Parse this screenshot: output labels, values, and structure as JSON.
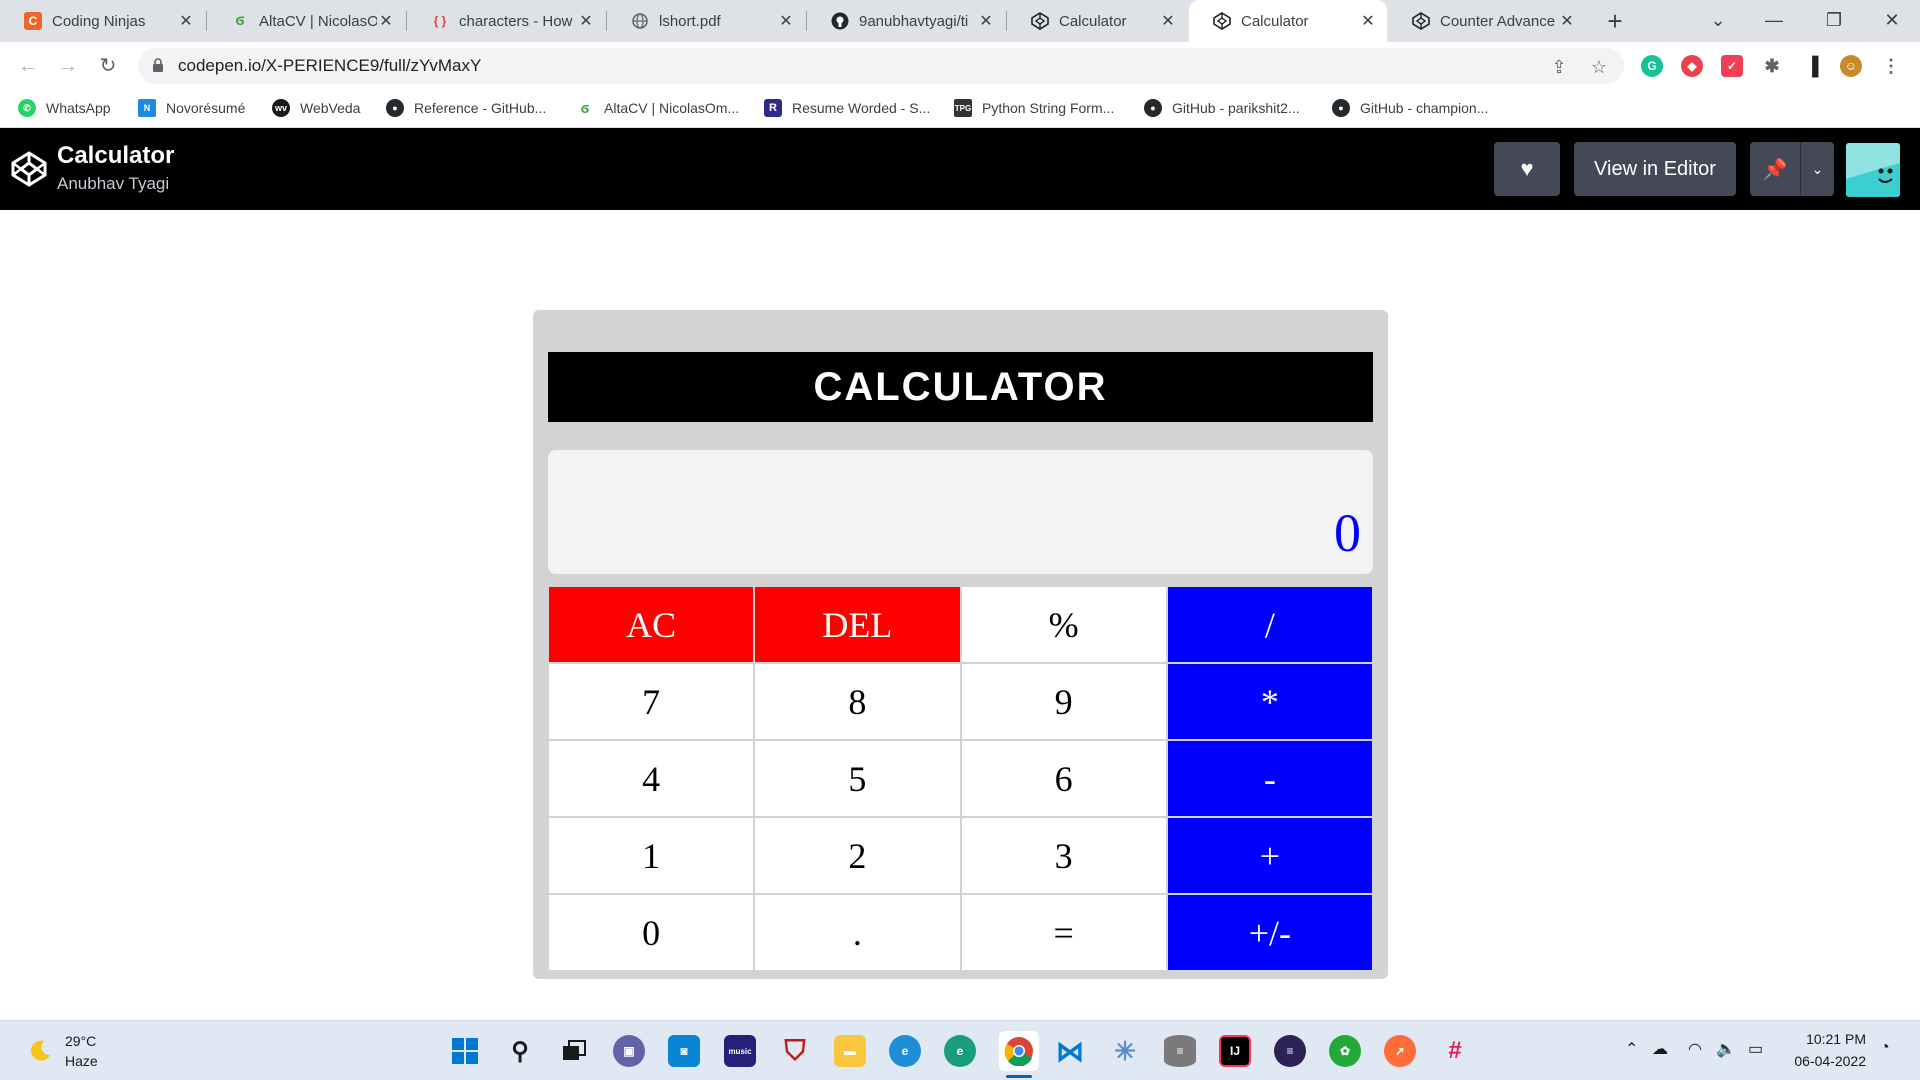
{
  "browser": {
    "tabs": [
      {
        "title": "Coding Ninjas",
        "icon": "coding-ninjas-icon",
        "active": false
      },
      {
        "title": "AltaCV | NicolasO",
        "icon": "overleaf-icon",
        "active": false
      },
      {
        "title": "characters - How",
        "icon": "braces-icon",
        "active": false
      },
      {
        "title": "lshort.pdf",
        "icon": "globe-icon",
        "active": false
      },
      {
        "title": "9anubhavtyagi/ti",
        "icon": "github-icon",
        "active": false
      },
      {
        "title": "Calculator",
        "icon": "codepen-icon",
        "active": false
      },
      {
        "title": "Calculator",
        "icon": "codepen-icon",
        "active": true
      },
      {
        "title": "Counter Advance",
        "icon": "codepen-icon",
        "active": false
      }
    ],
    "url": "codepen.io/X-PERIENCE9/full/zYvMaxY",
    "bookmarks": [
      {
        "label": "WhatsApp",
        "icon": "whatsapp-icon"
      },
      {
        "label": "Novorésumé",
        "icon": "novoresume-icon"
      },
      {
        "label": "WebVeda",
        "icon": "webveda-icon"
      },
      {
        "label": "Reference - GitHub...",
        "icon": "github-icon"
      },
      {
        "label": "AltaCV | NicolasOm...",
        "icon": "overleaf-icon"
      },
      {
        "label": "Resume Worded - S...",
        "icon": "resume-worded-icon"
      },
      {
        "label": "Python String Form...",
        "icon": "tpg-icon"
      },
      {
        "label": "GitHub - parikshit2...",
        "icon": "github-icon"
      },
      {
        "label": "GitHub - champion...",
        "icon": "github-icon"
      }
    ]
  },
  "codepen": {
    "title": "Calculator",
    "author": "Anubhav Tyagi",
    "view_in_editor": "View in Editor"
  },
  "calculator": {
    "heading": "CALCULATOR",
    "display": "0",
    "keys": [
      {
        "label": "AC",
        "style": "red"
      },
      {
        "label": "DEL",
        "style": "red"
      },
      {
        "label": "%",
        "style": "white"
      },
      {
        "label": "/",
        "style": "blue"
      },
      {
        "label": "7",
        "style": "white"
      },
      {
        "label": "8",
        "style": "white"
      },
      {
        "label": "9",
        "style": "white"
      },
      {
        "label": "*",
        "style": "blue"
      },
      {
        "label": "4",
        "style": "white"
      },
      {
        "label": "5",
        "style": "white"
      },
      {
        "label": "6",
        "style": "white"
      },
      {
        "label": "-",
        "style": "blue"
      },
      {
        "label": "1",
        "style": "white"
      },
      {
        "label": "2",
        "style": "white"
      },
      {
        "label": "3",
        "style": "white"
      },
      {
        "label": "+",
        "style": "blue"
      },
      {
        "label": "0",
        "style": "white"
      },
      {
        "label": ".",
        "style": "white"
      },
      {
        "label": "=",
        "style": "white"
      },
      {
        "label": "+/-",
        "style": "blue"
      }
    ],
    "colors": {
      "red": "#ff0000",
      "blue": "#0000ff",
      "display_text": "#0000ff"
    }
  },
  "taskbar": {
    "weather_temp": "29°C",
    "weather_desc": "Haze",
    "time": "10:21 PM",
    "date": "06-04-2022"
  }
}
